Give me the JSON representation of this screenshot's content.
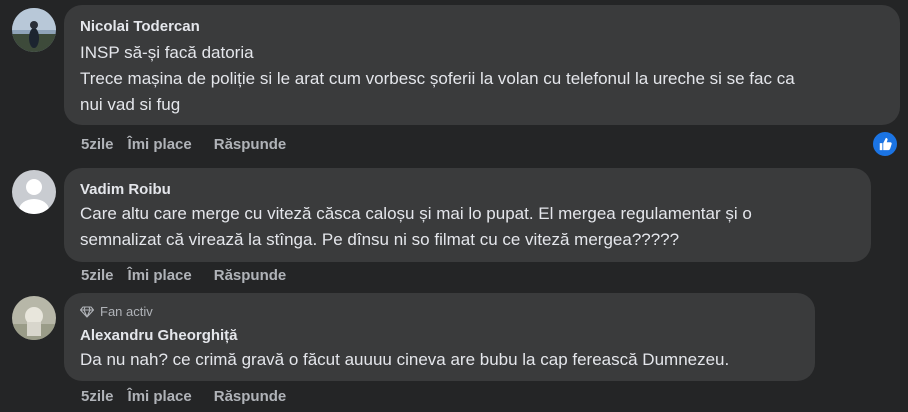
{
  "comments": [
    {
      "author": "Nicolai Todercan",
      "lines": [
        "INSP să-și facă datoria",
        "Trece mașina de poliție si le arat cum vorbesc șoferii la volan cu telefonul la ureche si se fac ca",
        "nui vad si fug"
      ],
      "time": "5zile",
      "like": "Îmi place",
      "reply": "Răspunde",
      "reaction_icon": "thumbs-up-icon"
    },
    {
      "author": "Vadim Roibu",
      "lines": [
        "Care altu care merge cu viteză căsca caloșu și mai lo pupat. El mergea regulamentar și o",
        "semnalizat că virează la stînga. Pe dînsu ni so filmat cu ce viteză mergea?????"
      ],
      "time": "5zile",
      "like": "Îmi place",
      "reply": "Răspunde"
    },
    {
      "badge": "Fan activ",
      "badge_icon": "diamond-icon",
      "author": "Alexandru Gheorghiță",
      "lines": [
        "Da nu nah? ce crimă gravă o făcut auuuu cineva are bubu la cap ferească Dumnezeu."
      ],
      "time": "5zile",
      "like": "Îmi place",
      "reply": "Răspunde"
    }
  ],
  "colors": {
    "background": "#242526",
    "bubble": "#3a3b3c",
    "text": "#e4e6eb",
    "secondary": "#b0b3b8",
    "like_blue": "#1b74e4"
  }
}
